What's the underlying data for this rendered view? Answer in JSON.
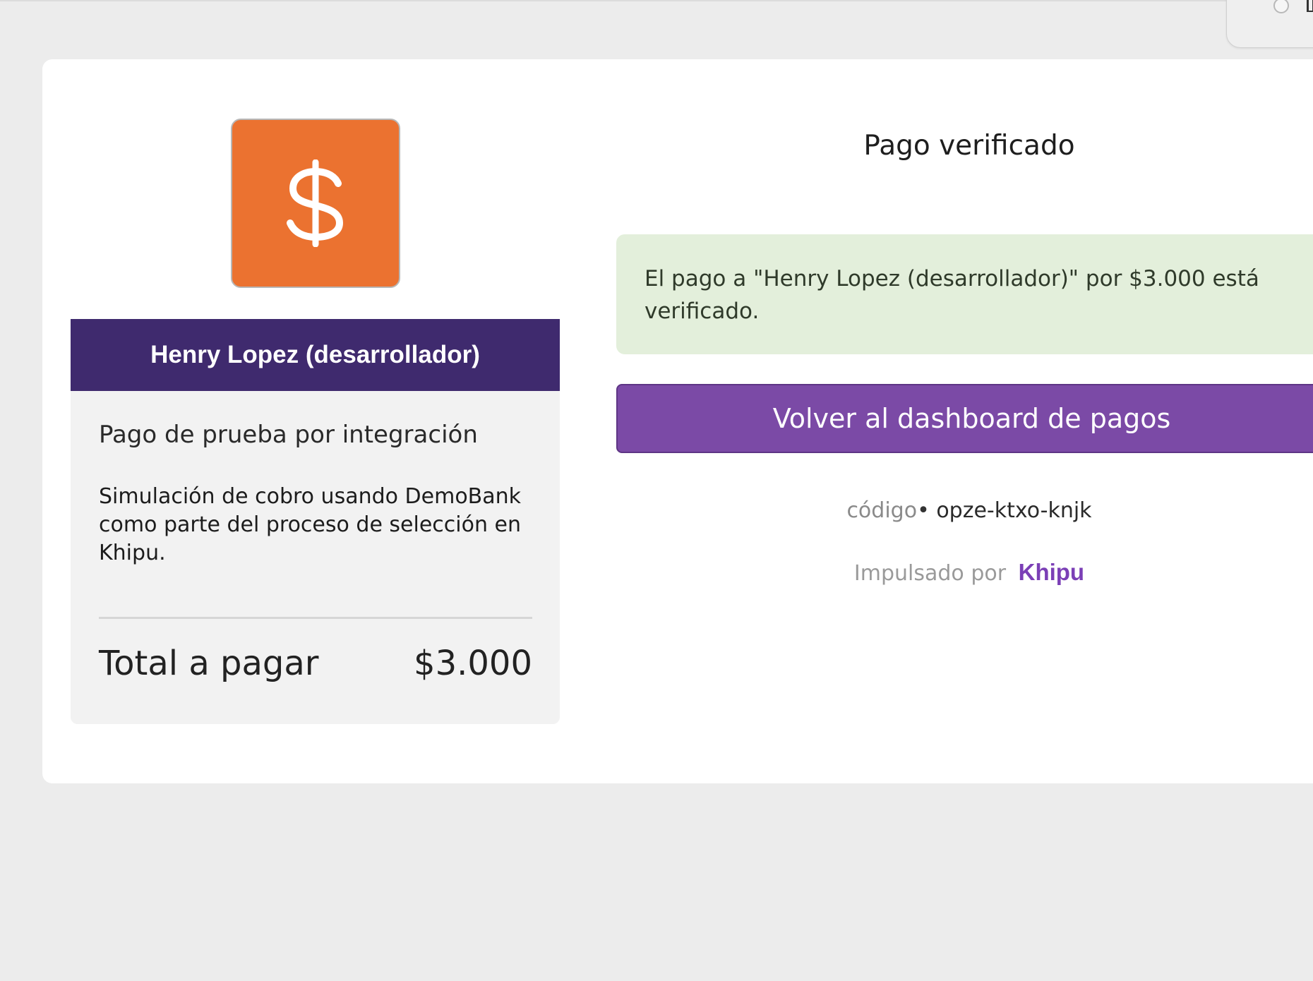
{
  "merchant": {
    "name": "Henry Lopez (desarrollador)",
    "logo_icon": "dollar-sign-icon",
    "logo_color": "#eb7230"
  },
  "payment": {
    "subject": "Pago de prueba por integración",
    "body": "Simulación de cobro usando DemoBank como parte del proceso de selección en Khipu.",
    "total_label": "Total a pagar",
    "total_value": "$3.000"
  },
  "status": {
    "title": "Pago verificado",
    "message": "El pago a \"Henry Lopez (desarrollador)\" por $3.000 está verificado."
  },
  "actions": {
    "back_label": "Volver al dashboard de pagos"
  },
  "code": {
    "label": "código",
    "separator": "•",
    "value": "opze-ktxo-knjk"
  },
  "footer": {
    "powered_by": "Impulsado por",
    "brand": "Khipu"
  },
  "colors": {
    "header": "#3f2a6e",
    "button": "#7b4aa6",
    "alert_bg": "#e3efdb",
    "brand": "#7b3fb6"
  }
}
